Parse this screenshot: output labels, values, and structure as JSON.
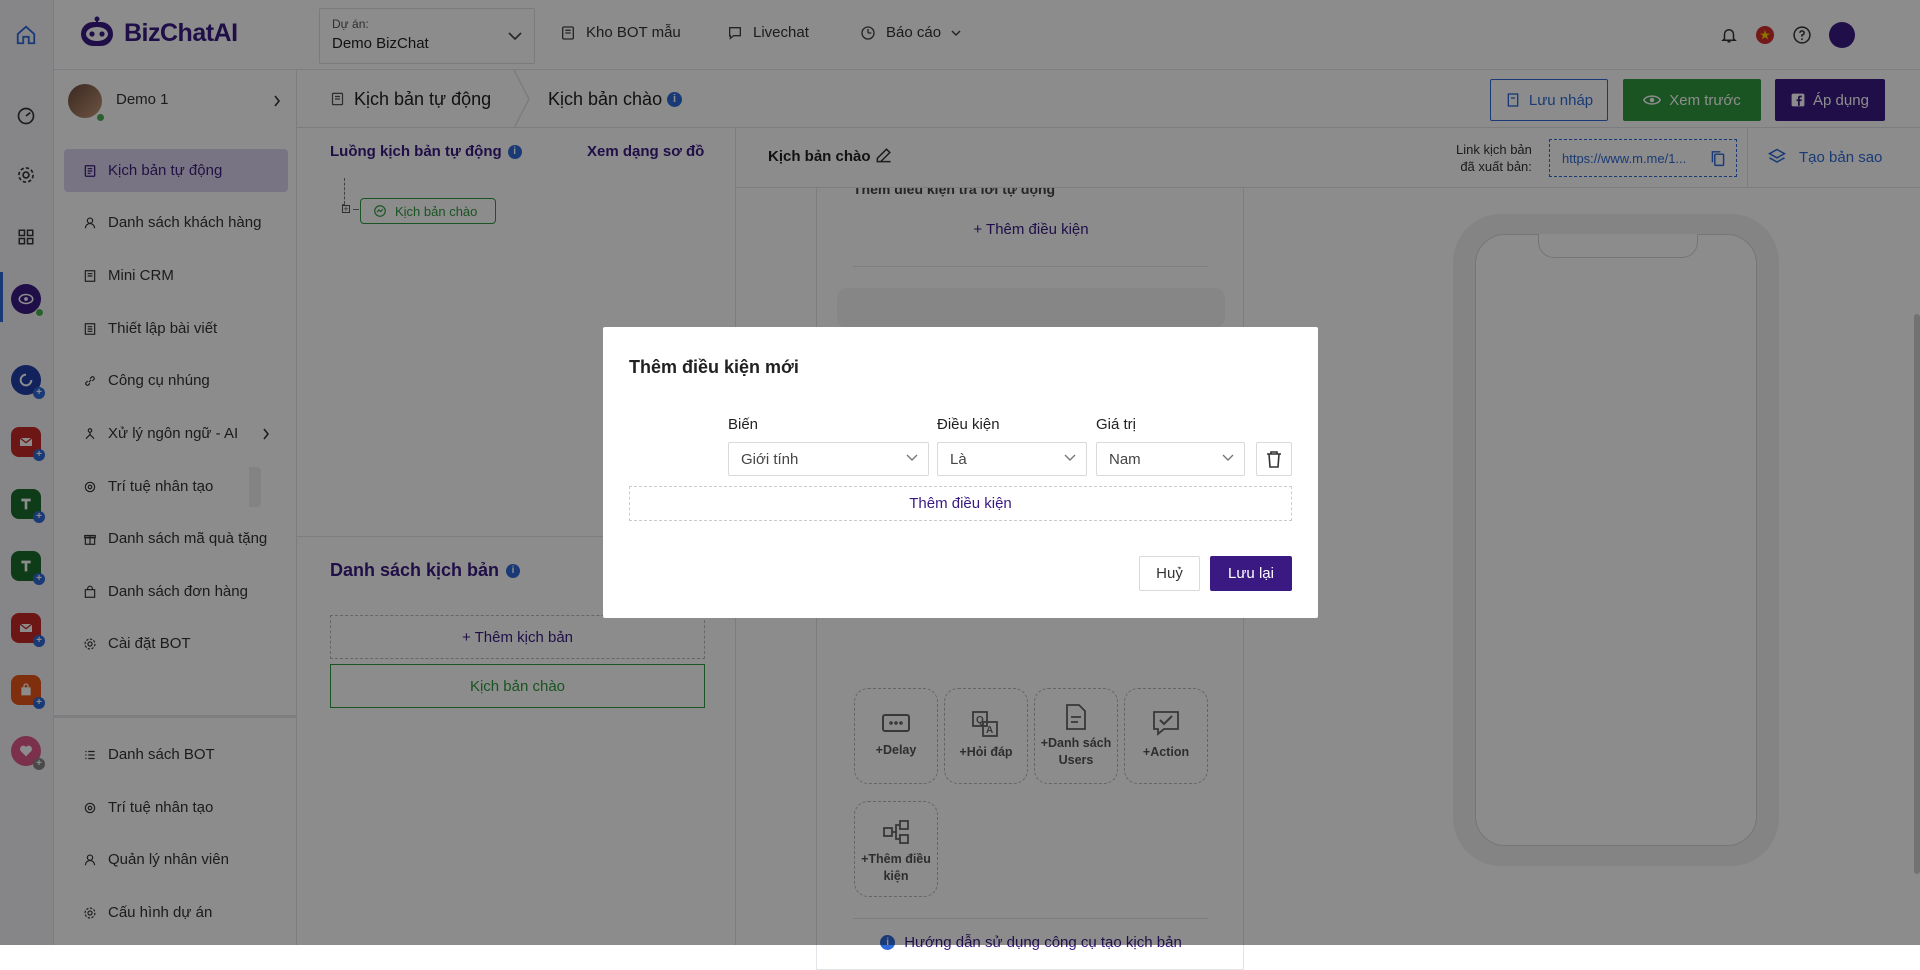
{
  "app": {
    "brand": "BizChatAI"
  },
  "topbar": {
    "project_label": "Dự án:",
    "project_value": "Demo BizChat",
    "nav": [
      {
        "label": "Kho BOT mẫu",
        "icon": "bot-template-icon"
      },
      {
        "label": "Livechat",
        "icon": "chat-icon"
      },
      {
        "label": "Báo cáo",
        "icon": "report-icon"
      }
    ]
  },
  "user": {
    "name": "Demo 1"
  },
  "sidebar": {
    "items": [
      {
        "label": "Kịch bản tự động",
        "icon": "script-icon",
        "active": true
      },
      {
        "label": "Danh sách khách hàng",
        "icon": "user-icon"
      },
      {
        "label": "Mini CRM",
        "icon": "crm-icon"
      },
      {
        "label": "Thiết lập bài viết",
        "icon": "post-icon"
      },
      {
        "label": "Công cụ nhúng",
        "icon": "link-icon"
      },
      {
        "label": "Xử lý ngôn ngữ - AI",
        "icon": "nlp-icon"
      },
      {
        "label": "Trí tuệ nhân tạo",
        "icon": "ai-icon"
      },
      {
        "label": "Danh sách mã quà tặng",
        "icon": "gift-icon"
      },
      {
        "label": "Danh sách đơn hàng",
        "icon": "bag-icon"
      },
      {
        "label": "Cài đặt BOT",
        "icon": "gear-icon"
      }
    ],
    "bottom_items": [
      {
        "label": "Danh sách BOT",
        "icon": "list-icon"
      },
      {
        "label": "Trí tuệ nhân tạo",
        "icon": "ai-icon"
      },
      {
        "label": "Quản lý nhân viên",
        "icon": "user-icon"
      },
      {
        "label": "Cấu hình dự án",
        "icon": "gear-icon"
      }
    ]
  },
  "breadcrumb": {
    "first": "Kịch bản tự động",
    "second": "Kịch bản chào"
  },
  "actions": {
    "draft": "Lưu nháp",
    "preview": "Xem trước",
    "apply": "Áp dụng"
  },
  "flow": {
    "title": "Luồng kịch bản tự động",
    "view_diagram": "Xem dạng sơ đồ",
    "node": "Kịch bản chào"
  },
  "script_list": {
    "title": "Danh sách kịch bản",
    "add": "+ Thêm kịch bản",
    "items": [
      "Kịch bản chào"
    ]
  },
  "editor": {
    "script_name": "Kịch bản chào",
    "link_label_1": "Link kịch bản",
    "link_label_2": "đã xuất bản:",
    "link_value": "https://www.m.me/1...",
    "copy_action": "Tạo bản sao",
    "condition_heading": "Thêm điều kiện trả lời tự động",
    "add_condition": "+ Thêm điều kiện",
    "tools": [
      "+Delay",
      "+Hỏi đáp",
      "+Danh sách Users",
      "+Action",
      "+Thêm điều kiện"
    ],
    "guide": "Hướng dẫn sử dụng công cụ tạo kịch bản"
  },
  "modal": {
    "title": "Thêm điều kiện mới",
    "col_variable": "Biến",
    "col_condition": "Điều kiện",
    "col_value": "Giá trị",
    "variable_value": "Giới tính",
    "condition_value": "Là",
    "value_value": "Nam",
    "add_condition": "Thêm điều kiện",
    "cancel": "Huỷ",
    "save": "Lưu lại"
  },
  "colors": {
    "primary": "#3a1a82",
    "green": "#2e9a3e",
    "accent_blue": "#2f6bd8"
  }
}
